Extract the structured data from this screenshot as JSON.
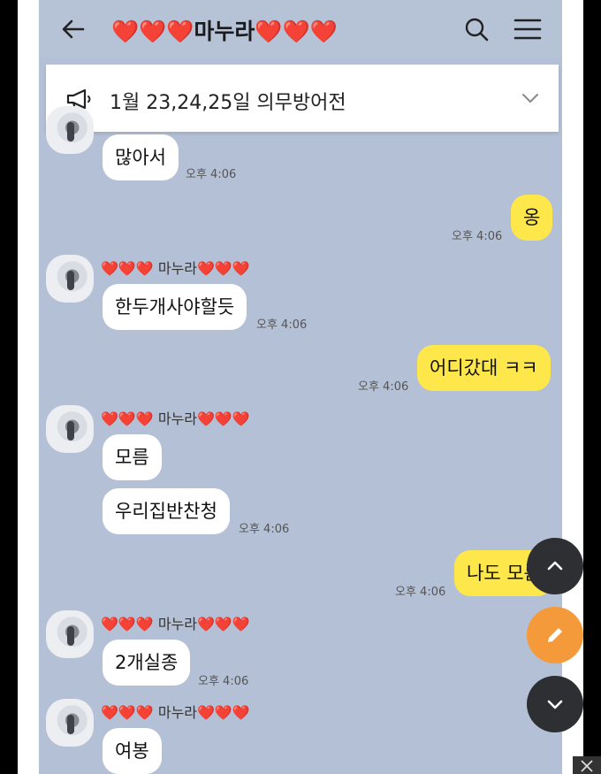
{
  "header": {
    "title_prefix": "❤️❤️❤️",
    "title_name": "마누라",
    "title_suffix": "❤️❤️❤️"
  },
  "notice": {
    "text": "1월 23,24,25일 의무방어전"
  },
  "sender_name": "❤️❤️❤️ 마누라❤️❤️❤️",
  "messages": {
    "m1": {
      "text": "많아서",
      "time": "오후 4:06"
    },
    "m2": {
      "text": "옹",
      "time": "오후 4:06"
    },
    "m3": {
      "text": "한두개사야할듯",
      "time": "오후 4:06"
    },
    "m4": {
      "text": "어디갔대 ㅋㅋ",
      "time": "오후 4:06"
    },
    "m5": {
      "text": "모름"
    },
    "m6": {
      "text": "우리집반찬청",
      "time": "오후 4:06"
    },
    "m7": {
      "text": "나도 모름",
      "time": "오후 4:06"
    },
    "m8": {
      "text": "2개실종",
      "time": "오후 4:06"
    },
    "m9": {
      "text": "여봉"
    }
  },
  "icons": {
    "back": "back-arrow-icon",
    "search": "search-icon",
    "menu": "menu-icon",
    "speaker": "megaphone-icon",
    "chevron": "chevron-down-icon",
    "scroll_up": "chevron-up-icon",
    "edit": "pencil-icon",
    "scroll_down": "chevron-down-icon",
    "close": "close-icon"
  },
  "colors": {
    "chat_bg": "#b4c0d5",
    "outgoing_bubble": "#fde74b",
    "incoming_bubble": "#ffffff",
    "fab_orange": "#f59a3a",
    "fab_dark": "#2d2f33",
    "heart": "#e0262b"
  }
}
